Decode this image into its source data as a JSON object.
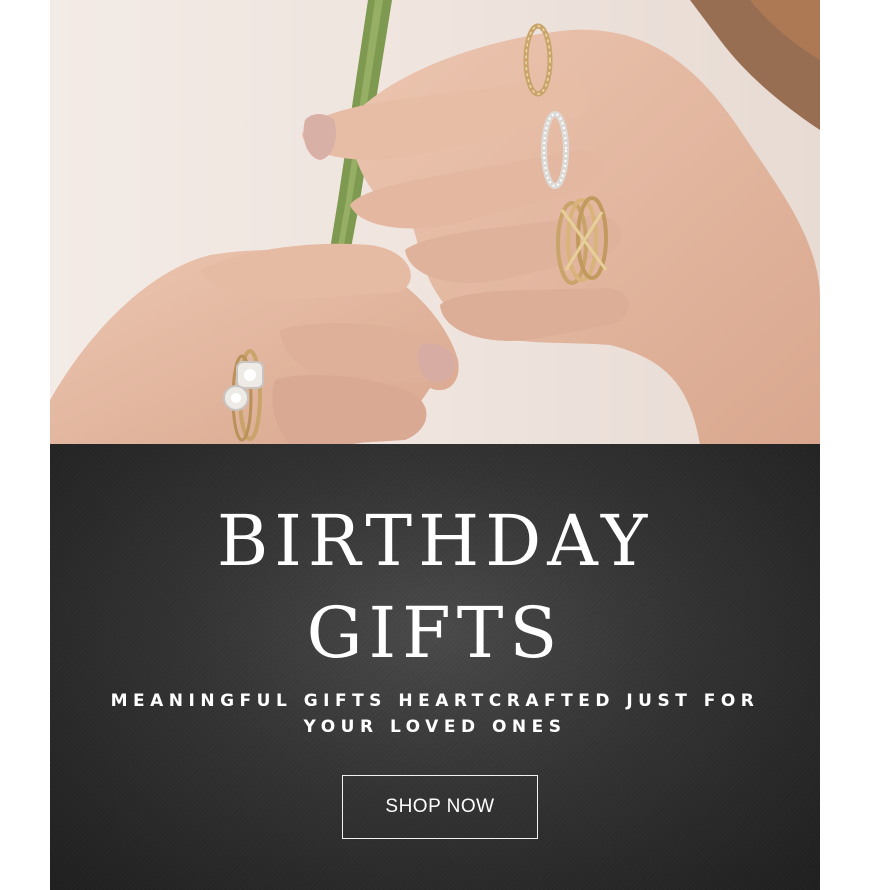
{
  "hero": {
    "image_subject": "hands-with-rings-holding-stem",
    "colors": {
      "backdrop": "#efe6e1",
      "skin": "#e2b7a0",
      "stem": "#7e9950",
      "gold": "#c9a46a",
      "silver": "#d9d6d2"
    }
  },
  "promo": {
    "headline_line1": "BIRTHDAY",
    "headline_line2": "GIFTS",
    "subtitle": "MEANINGFUL GIFTS HEARTCRAFTED JUST FOR YOUR LOVED ONES",
    "cta_label": "SHOP NOW",
    "colors": {
      "panel": "#333333",
      "text": "#ffffff",
      "button_border": "#f2f2f2"
    }
  }
}
